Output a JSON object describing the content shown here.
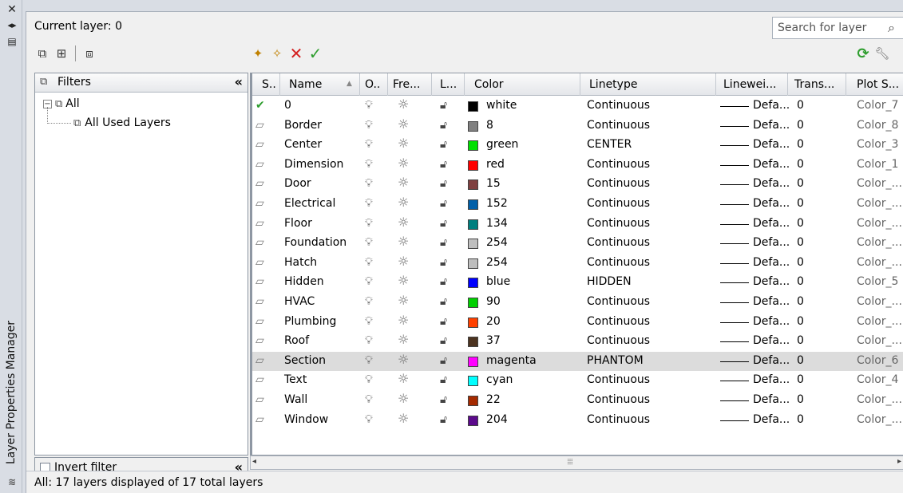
{
  "palette": {
    "title": "Layer Properties Manager"
  },
  "header": {
    "current_layer": "Current layer: 0",
    "search_placeholder": "Search for layer"
  },
  "filters": {
    "title": "Filters",
    "tree": {
      "root": "All",
      "child": "All Used Layers"
    },
    "invert_label": "Invert filter"
  },
  "columns": {
    "status": "S..",
    "name": "Name",
    "on": "O..",
    "freeze": "Fre...",
    "lock": "L...",
    "color": "Color",
    "linetype": "Linetype",
    "lineweight": "Linewei...",
    "transparency": "Trans...",
    "plot_style": "Plot S..."
  },
  "colors": {
    "current_check": "#2f9e2f",
    "selected_row": "#dcdcdc"
  },
  "layers": [
    {
      "name": "0",
      "current": true,
      "color": "white",
      "swatch": "#000000",
      "linetype": "Continuous",
      "lineweight": "Defa...",
      "transparency": "0",
      "plot_style": "Color_7"
    },
    {
      "name": "Border",
      "color": "8",
      "swatch": "#808080",
      "linetype": "Continuous",
      "lineweight": "Defa...",
      "transparency": "0",
      "plot_style": "Color_8"
    },
    {
      "name": "Center",
      "color": "green",
      "swatch": "#00e000",
      "linetype": "CENTER",
      "lineweight": "Defa...",
      "transparency": "0",
      "plot_style": "Color_3"
    },
    {
      "name": "Dimension",
      "color": "red",
      "swatch": "#ff0000",
      "linetype": "Continuous",
      "lineweight": "Defa...",
      "transparency": "0",
      "plot_style": "Color_1"
    },
    {
      "name": "Door",
      "color": "15",
      "swatch": "#7f3f3f",
      "linetype": "Continuous",
      "lineweight": "Defa...",
      "transparency": "0",
      "plot_style": "Color_..."
    },
    {
      "name": "Electrical",
      "color": "152",
      "swatch": "#005fa8",
      "linetype": "Continuous",
      "lineweight": "Defa...",
      "transparency": "0",
      "plot_style": "Color_..."
    },
    {
      "name": "Floor",
      "color": "134",
      "swatch": "#007f7f",
      "linetype": "Continuous",
      "lineweight": "Defa...",
      "transparency": "0",
      "plot_style": "Color_..."
    },
    {
      "name": "Foundation",
      "color": "254",
      "swatch": "#bebebe",
      "linetype": "Continuous",
      "lineweight": "Defa...",
      "transparency": "0",
      "plot_style": "Color_..."
    },
    {
      "name": "Hatch",
      "color": "254",
      "swatch": "#bebebe",
      "linetype": "Continuous",
      "lineweight": "Defa...",
      "transparency": "0",
      "plot_style": "Color_..."
    },
    {
      "name": "Hidden",
      "color": "blue",
      "swatch": "#0000ff",
      "linetype": "HIDDEN",
      "lineweight": "Defa...",
      "transparency": "0",
      "plot_style": "Color_5"
    },
    {
      "name": "HVAC",
      "color": "90",
      "swatch": "#00d000",
      "linetype": "Continuous",
      "lineweight": "Defa...",
      "transparency": "0",
      "plot_style": "Color_..."
    },
    {
      "name": "Plumbing",
      "color": "20",
      "swatch": "#ff4000",
      "linetype": "Continuous",
      "lineweight": "Defa...",
      "transparency": "0",
      "plot_style": "Color_..."
    },
    {
      "name": "Roof",
      "color": "37",
      "swatch": "#4c3320",
      "linetype": "Continuous",
      "lineweight": "Defa...",
      "transparency": "0",
      "plot_style": "Color_..."
    },
    {
      "name": "Section",
      "selected": true,
      "color": "magenta",
      "swatch": "#ff00ff",
      "linetype": "PHANTOM",
      "lineweight": "Defa...",
      "transparency": "0",
      "plot_style": "Color_6"
    },
    {
      "name": "Text",
      "color": "cyan",
      "swatch": "#00ffff",
      "linetype": "Continuous",
      "lineweight": "Defa...",
      "transparency": "0",
      "plot_style": "Color_4"
    },
    {
      "name": "Wall",
      "color": "22",
      "swatch": "#a52a00",
      "linetype": "Continuous",
      "lineweight": "Defa...",
      "transparency": "0",
      "plot_style": "Color_..."
    },
    {
      "name": "Window",
      "color": "204",
      "swatch": "#5c0a8c",
      "linetype": "Continuous",
      "lineweight": "Defa...",
      "transparency": "0",
      "plot_style": "Color_..."
    }
  ],
  "status_bar": "All: 17 layers displayed of 17 total layers"
}
